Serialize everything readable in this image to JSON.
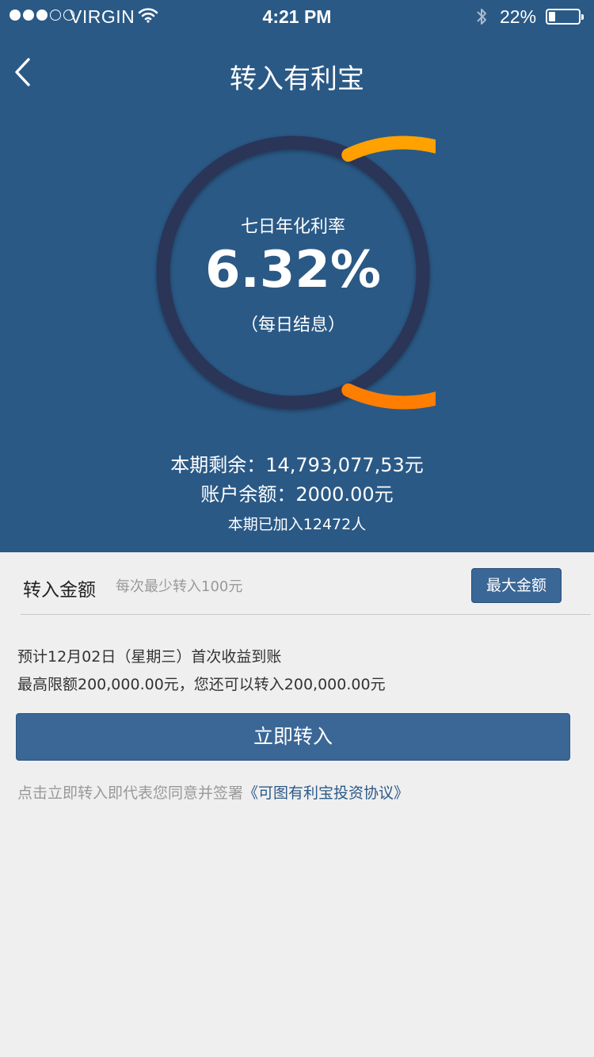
{
  "status_bar": {
    "carrier": "VIRGIN",
    "time": "4:21 PM",
    "battery": "22%",
    "battery_level": 0.22,
    "signal_bars_filled": 3,
    "signal_bars_total": 5
  },
  "nav": {
    "back_icon": "chevron-left-icon",
    "title": "转入有利宝"
  },
  "rate_gauge": {
    "label": "七日年化利率",
    "rate": "6.32%",
    "note": "（每日结息）",
    "track_color": "#2a3558",
    "progress_color_start": "#ffa200",
    "progress_color_end": "#ff7d00",
    "progress_fraction": 0.64
  },
  "summary": {
    "remaining": "本期剩余：14,793,077,53元",
    "balance": "账户余额：2000.00元",
    "joined": "本期已加入12472人"
  },
  "amount": {
    "label": "转入金额",
    "placeholder": "每次最少转入100元",
    "value": "",
    "max_button": "最大金额"
  },
  "notes": {
    "line1": "预计12月02日（星期三）首次收益到账",
    "line2": "最高限额200,000.00元，您还可以转入200,000.00元"
  },
  "submit_button": "立即转入",
  "agreement": {
    "prefix": "点击立即转入即代表您同意并签署",
    "link": "《可图有利宝投资协议》"
  },
  "colors": {
    "header_bg": "#2a5986",
    "page_bg": "#efefef",
    "button_bg": "#3b6796",
    "link": "#2c5a88"
  }
}
